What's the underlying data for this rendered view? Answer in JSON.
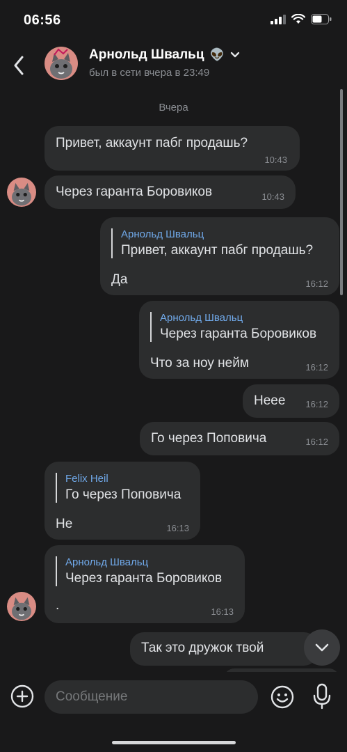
{
  "status_bar": {
    "time": "06:56"
  },
  "header": {
    "name": "Арнольд Швальц",
    "emoji": "👽",
    "last_seen": "был в сети вчера в 23:49"
  },
  "date_divider": "Вчера",
  "messages": [
    {
      "text": "Привет, аккаунт пабг продашь?",
      "time": "10:43"
    },
    {
      "text": "Через гаранта Боровиков",
      "time": "10:43"
    },
    {
      "reply_name": "Арнольд Швальц",
      "reply_text": "Привет, аккаунт пабг продашь?",
      "text": "Да",
      "time": "16:12"
    },
    {
      "reply_name": "Арнольд Швальц",
      "reply_text": "Через гаранта Боровиков",
      "text": "Что за ноу нейм",
      "time": "16:12"
    },
    {
      "text": "Нeee",
      "time": "16:12"
    },
    {
      "text": "Го через Поповича",
      "time": "16:12"
    },
    {
      "reply_name": "Felix Heil",
      "reply_text": "Го через Поповича",
      "text": "Не",
      "time": "16:13"
    },
    {
      "reply_name": "Арнольд Швальц",
      "reply_text": "Через гаранта Боровиков",
      "text": ".",
      "time": "16:13"
    },
    {
      "text": "Так это дружок твой",
      "time": ""
    }
  ],
  "composer": {
    "placeholder": "Сообщение"
  },
  "icons": {
    "back": "chevron-left-icon",
    "expand": "chevron-down-icon",
    "scroll_down": "chevron-down-icon",
    "attach": "plus-circle-icon",
    "sticker": "smile-icon",
    "mic": "microphone-icon"
  },
  "colors": {
    "background": "#19191a",
    "bubble": "#2c2d2e",
    "reply_name": "#71aaeb",
    "secondary_text": "#8a8d92"
  }
}
